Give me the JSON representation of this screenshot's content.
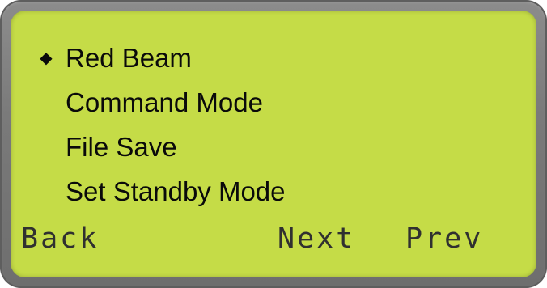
{
  "display": {
    "background_color": "#c5dc47",
    "bezel_color": "#7a7a7a"
  },
  "menu": {
    "cursor_icon": "diamond-bullet-icon",
    "cursor_glyph": "◆",
    "selected_index": 0,
    "items": [
      {
        "label": "Red Beam"
      },
      {
        "label": "Command Mode"
      },
      {
        "label": "File Save"
      },
      {
        "label": "Set Standby Mode"
      }
    ]
  },
  "softkeys": {
    "back_label": "Back",
    "next_label": "Next",
    "prev_label": "Prev"
  }
}
